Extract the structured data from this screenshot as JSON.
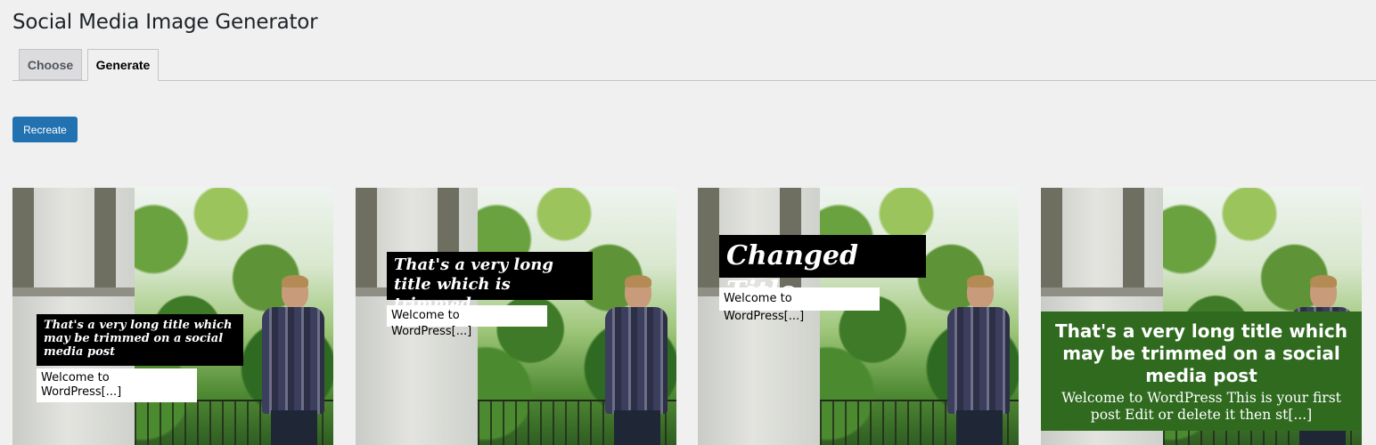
{
  "page": {
    "title": "Social Media Image Generator"
  },
  "tabs": [
    {
      "label": "Choose",
      "active": false
    },
    {
      "label": "Generate",
      "active": true
    }
  ],
  "actions": {
    "recreate_label": "Recreate"
  },
  "colors": {
    "primary_button": "#2271b1",
    "green_overlay": "#2f6a1f"
  },
  "cards": [
    {
      "title": "That's a very long title which may be trimmed on a social media post",
      "excerpt": "Welcome to WordPress[...]"
    },
    {
      "title": "That's a very long title which is trimmed",
      "excerpt": "Welcome to WordPress[...]"
    },
    {
      "title": "Changed Title",
      "excerpt": "Welcome to WordPress[...]"
    },
    {
      "title": "That's a very long title which may be trimmed on a social media post",
      "excerpt": "Welcome to WordPress This is your first post Edit or delete it then st[...]"
    }
  ]
}
